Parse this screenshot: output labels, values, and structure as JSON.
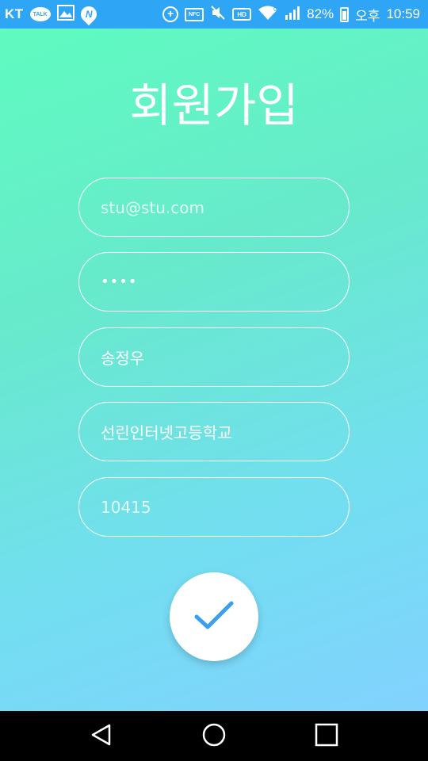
{
  "status_bar": {
    "carrier": "KT",
    "talk_label": "TALK",
    "nfc_label": "NFC",
    "hd_label": "HD",
    "network_label": "G",
    "battery": "82%",
    "ampm": "오후",
    "time": "10:59",
    "battery_level": 0.82
  },
  "page": {
    "title": "회원가입"
  },
  "form": {
    "email": "stu@stu.com",
    "password_masked": "••••",
    "name": "송정우",
    "school": "선린인터넷고등학교",
    "zipcode": "10415"
  },
  "colors": {
    "status_bar": "#2fa5f6",
    "gradient_start": "#5ffbc0",
    "gradient_end": "#82d2ff",
    "check_icon": "#3a9ff0"
  },
  "icons": {
    "submit": "check-icon",
    "nav_back": "back-triangle-icon",
    "nav_home": "home-circle-icon",
    "nav_recent": "recent-square-icon"
  }
}
